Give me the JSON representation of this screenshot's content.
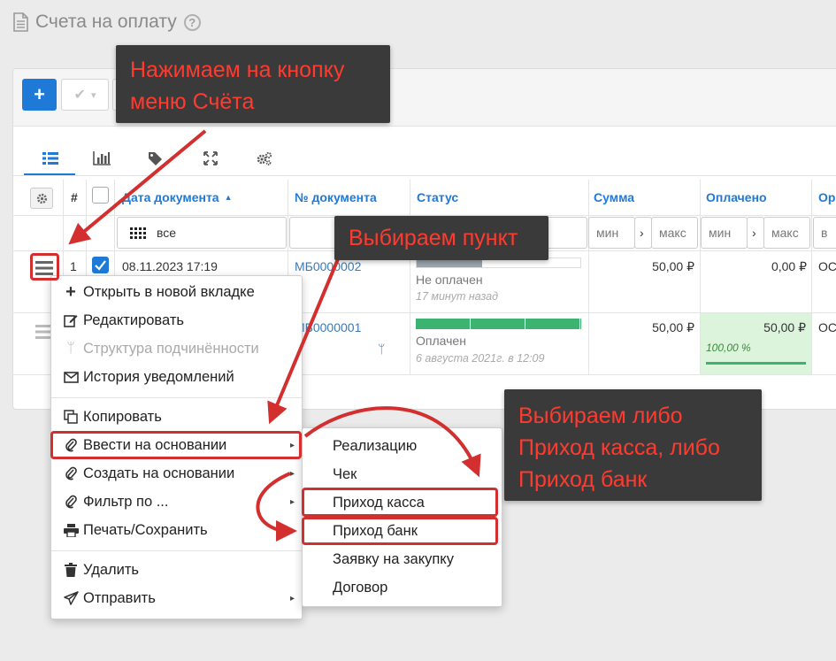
{
  "page": {
    "title": "Счета на оплату",
    "help_icon": "?"
  },
  "toolbar": {
    "add_label": "+",
    "check_label": "✔",
    "check_caret": "▾"
  },
  "grid": {
    "columns": {
      "hash": "#",
      "date": "Дата документа",
      "sort_indicator": "▲",
      "number": "№ документа",
      "status": "Статус",
      "sum": "Сумма",
      "paid": "Оплачено",
      "org": "Ор"
    },
    "filters": {
      "date": "все",
      "sum_min": "мин",
      "sum_max": "макс",
      "paid_min": "мин",
      "paid_max": "макс",
      "range_arrow": "›",
      "org": "в"
    },
    "rows": [
      {
        "index": "1",
        "date": "08.11.2023 17:19",
        "number": "МБ0000002",
        "status": "Не оплачен",
        "status_time": "17 минут назад",
        "progress": 0.4,
        "sum": "50,00 ₽",
        "paid": "0,00 ₽",
        "org": "ОС"
      },
      {
        "number": "МБ0000001",
        "status": "Оплачен",
        "status_time": "6 августа 2021г. в 12:09",
        "progress": 1.0,
        "sum": "50,00 ₽",
        "paid": "50,00 ₽",
        "paid_percent": "100,00 %",
        "org": "ОС"
      }
    ]
  },
  "context_menu": {
    "items": [
      {
        "label": "Открыть в новой вкладке"
      },
      {
        "label": "Редактировать"
      },
      {
        "label": "Структура подчинённости"
      },
      {
        "label": "История уведомлений"
      },
      {
        "label": "Копировать"
      },
      {
        "label": "Ввести на основании"
      },
      {
        "label": "Создать на основании"
      },
      {
        "label": "Фильтр по ..."
      },
      {
        "label": "Печать/Сохранить"
      },
      {
        "label": "Удалить"
      },
      {
        "label": "Отправить"
      }
    ],
    "caret": "▸"
  },
  "submenu": {
    "items": [
      {
        "label": "Реализацию"
      },
      {
        "label": "Чек"
      },
      {
        "label": "Приход касса"
      },
      {
        "label": "Приход банк"
      },
      {
        "label": "Заявку на закупку"
      },
      {
        "label": "Договор"
      }
    ]
  },
  "callouts": {
    "menu_button": {
      "line1": "Нажимаем на кнопку",
      "line2": "меню Счёта"
    },
    "choose_item": {
      "line1": "Выбираем пункт"
    },
    "choose_either": {
      "line1": "Выбираем либо",
      "line2": "Приход касса, либо",
      "line3": "Приход банк"
    }
  },
  "colors": {
    "accent": "#1e7ad6",
    "paid_green": "#3cb371",
    "unpaid_gray": "#9aa5ad",
    "annotation_red": "#d32f2f",
    "callout_bg": "#3a3a3a",
    "callout_text": "#ff3b30"
  }
}
